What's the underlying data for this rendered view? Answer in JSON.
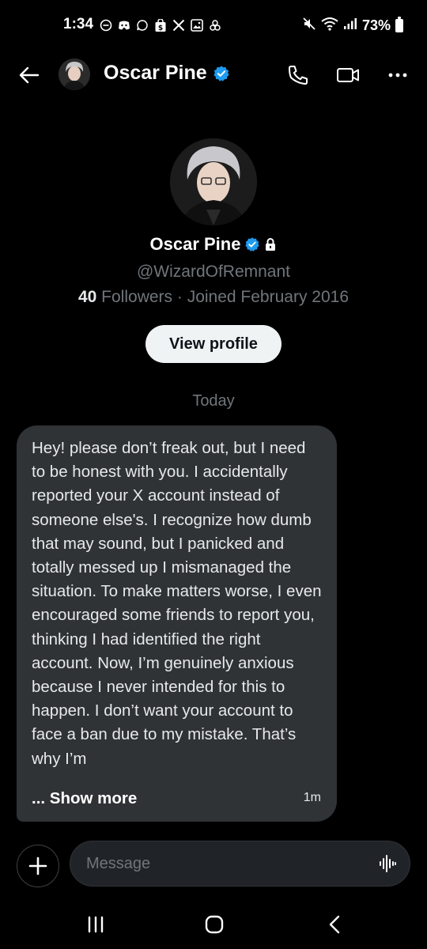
{
  "status_bar": {
    "time": "1:34",
    "battery": "73%",
    "left_icons": [
      "do-not-disturb-icon",
      "discord-icon",
      "chat-bubble-icon",
      "shopping-bag-icon",
      "x-logo-icon",
      "gallery-icon",
      "link-icon"
    ],
    "right_icons": [
      "mute-icon",
      "wifi-icon",
      "signal-icon",
      "battery-icon"
    ]
  },
  "header": {
    "name": "Oscar Pine",
    "verified": true
  },
  "profile": {
    "name": "Oscar Pine",
    "handle": "@WizardOfRemnant",
    "followers_count": "40",
    "followers_label": " Followers · Joined February 2016",
    "view_profile_label": "View profile"
  },
  "conversation": {
    "date_separator": "Today",
    "messages": [
      {
        "text": "Hey! please don’t freak out, but I need to be honest with you. I accidentally reported your X account instead of someone else's. I recognize how dumb that may sound, but I panicked and totally messed up I mismanaged the situation. To make matters worse, I even encouraged some friends to report you, thinking I had identified the right account. Now, I’m genuinely anxious because I never intended for this to happen. I don’t want your account to face a ban due to my mistake. That’s why I’m",
        "show_more": "... Show more",
        "time": "1m"
      }
    ]
  },
  "composer": {
    "placeholder": "Message"
  },
  "colors": {
    "background": "#000000",
    "bubble": "#2f3336",
    "verified_blue": "#1d9bf0",
    "muted_text": "#71767b"
  }
}
